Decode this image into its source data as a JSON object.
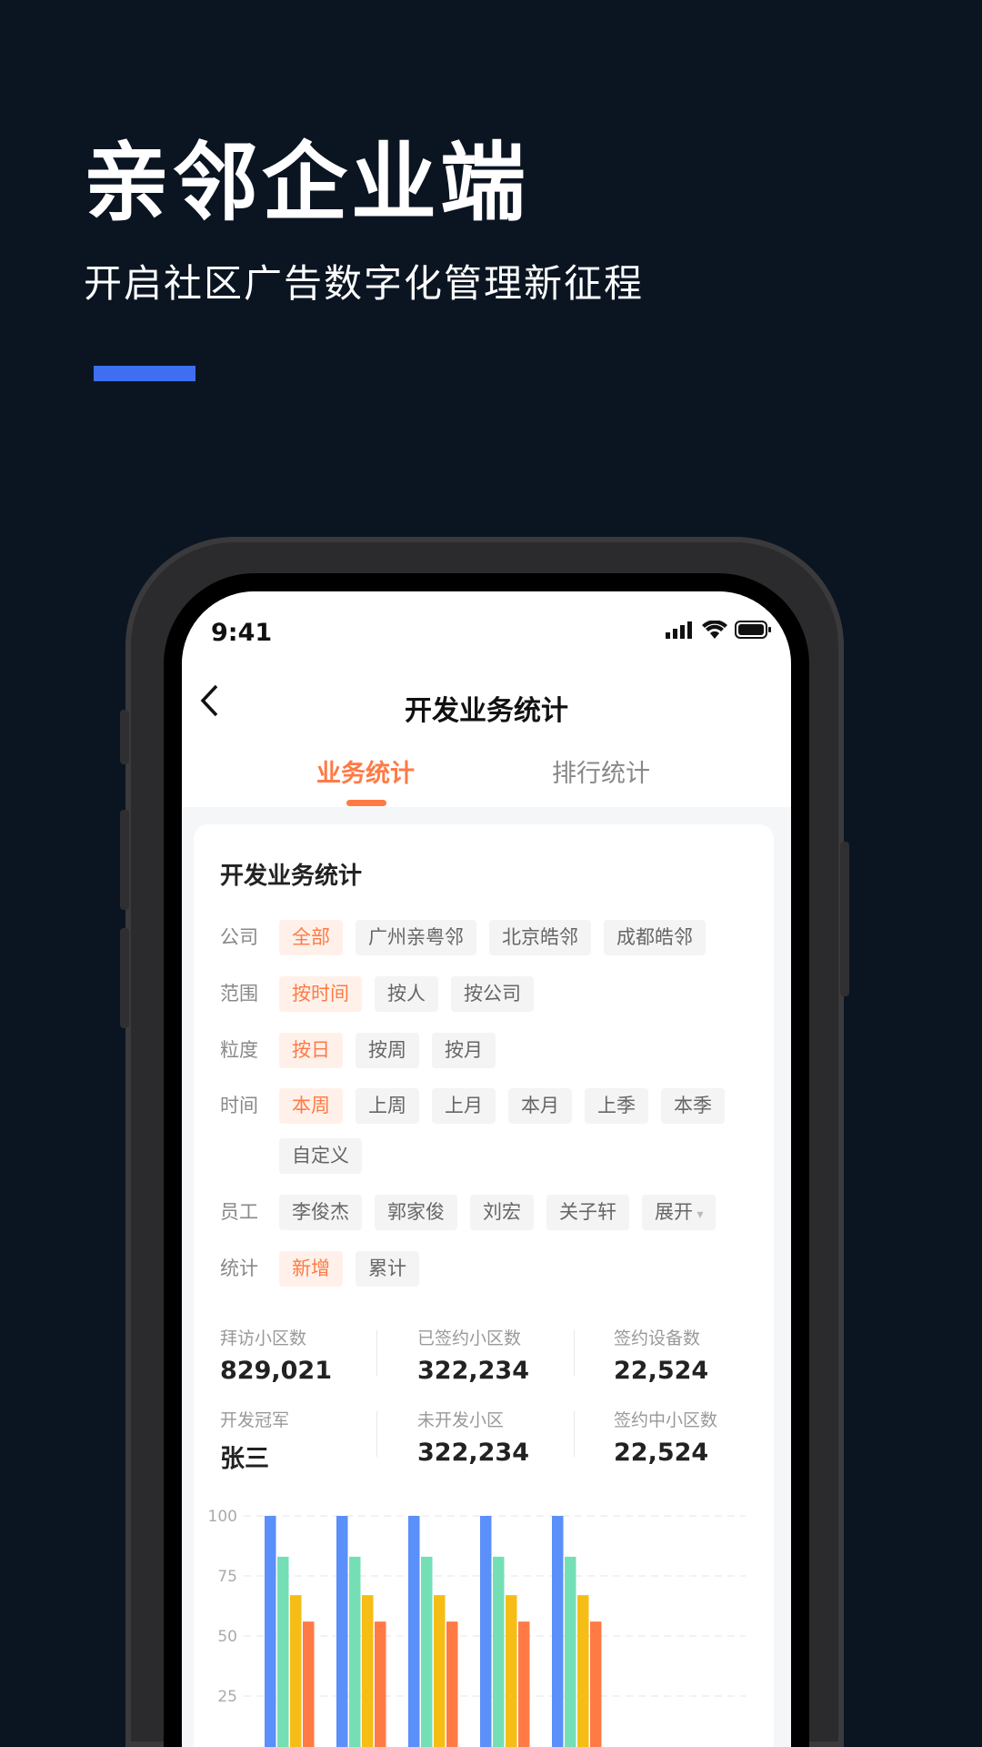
{
  "hero": {
    "title": "亲邻企业端",
    "subtitle": "开启社区广告数字化管理新征程",
    "accent": "#3f6ff0"
  },
  "status_bar": {
    "time": "9:41",
    "icons": [
      "signal-icon",
      "wifi-icon",
      "battery-icon"
    ]
  },
  "nav": {
    "back_icon": "chevron-left-icon",
    "title": "开发业务统计"
  },
  "tabs": [
    {
      "label": "业务统计",
      "active": true
    },
    {
      "label": "排行统计",
      "active": false
    }
  ],
  "card": {
    "title": "开发业务统计",
    "filters": [
      {
        "label": "公司",
        "options": [
          "全部",
          "广州亲粤邻",
          "北京皓邻",
          "成都皓邻"
        ],
        "selected": 0
      },
      {
        "label": "范围",
        "options": [
          "按时间",
          "按人",
          "按公司"
        ],
        "selected": 0
      },
      {
        "label": "粒度",
        "options": [
          "按日",
          "按周",
          "按月"
        ],
        "selected": 0
      },
      {
        "label": "时间",
        "options": [
          "本周",
          "上周",
          "上月",
          "本月",
          "上季",
          "本季",
          "自定义"
        ],
        "selected": 0
      },
      {
        "label": "员工",
        "options": [
          "李俊杰",
          "郭家俊",
          "刘宏",
          "关子轩",
          "展开"
        ],
        "selected": -1
      },
      {
        "label": "统计",
        "options": [
          "新增",
          "累计"
        ],
        "selected": 0
      }
    ],
    "stats": [
      {
        "label": "拜访小区数",
        "value": "829,021"
      },
      {
        "label": "已签约小区数",
        "value": "322,234"
      },
      {
        "label": "签约设备数",
        "value": "22,524"
      },
      {
        "label": "开发冠军",
        "value": "张三"
      },
      {
        "label": "未开发小区",
        "value": "322,234"
      },
      {
        "label": "签约中小区数",
        "value": "22,524"
      }
    ]
  },
  "colors": {
    "accent": "#ff7a45",
    "selected_bg": "#fff1ea"
  },
  "chart_data": {
    "type": "bar",
    "yticks": [
      "100",
      "75",
      "50",
      "25"
    ],
    "ylim": [
      0,
      100
    ],
    "grid": true,
    "series": [
      {
        "color": "#5b8ff9",
        "values": [
          100,
          100,
          100,
          100,
          100
        ]
      },
      {
        "color": "#74dfb4",
        "values": [
          83,
          83,
          83,
          83,
          83
        ]
      },
      {
        "color": "#f6bd16",
        "values": [
          67,
          67,
          67,
          67,
          67
        ]
      },
      {
        "color": "#ff7a45",
        "values": [
          56,
          56,
          56,
          56,
          56
        ]
      }
    ]
  }
}
